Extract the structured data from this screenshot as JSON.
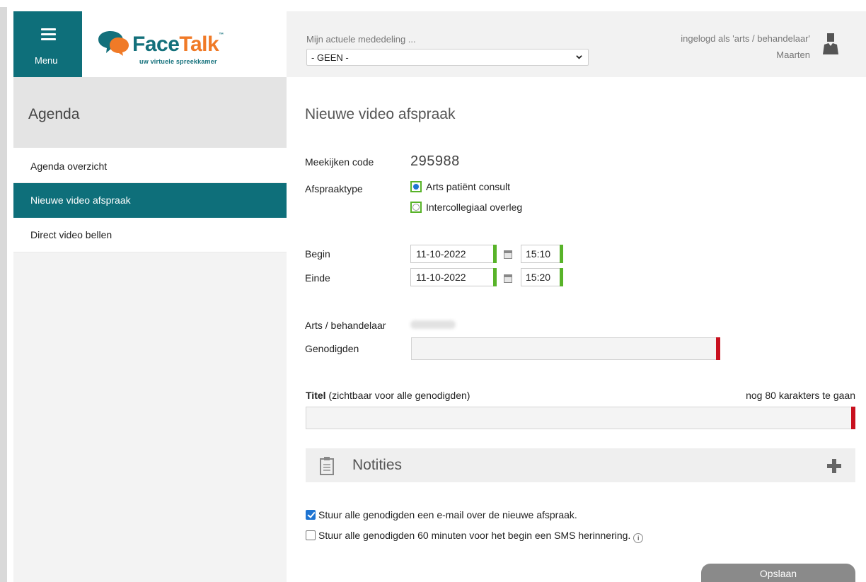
{
  "menu": {
    "label": "Menu",
    "icon": "hamburger-icon"
  },
  "logo": {
    "face": "Face",
    "talk": "Talk",
    "tm": "™",
    "tagline": "uw virtuele spreekkamer",
    "icon": "speech-bubbles-icon"
  },
  "header": {
    "notice_label": "Mijn actuele mededeling ...",
    "notice_value": "- GEEN -",
    "logged_in_as": "ingelogd als 'arts / behandelaar'",
    "user_name": "Maarten",
    "avatar_icon": "user-avatar-icon"
  },
  "sidebar": {
    "section_title": "Agenda",
    "items": [
      {
        "label": "Agenda overzicht",
        "active": false
      },
      {
        "label": "Nieuwe video afspraak",
        "active": true
      },
      {
        "label": "Direct video bellen",
        "active": false
      }
    ]
  },
  "form": {
    "page_title": "Nieuwe video afspraak",
    "code_label": "Meekijken code",
    "code_value": "295988",
    "type_label": "Afspraaktype",
    "type_options": [
      {
        "label": "Arts patiënt consult",
        "selected": true
      },
      {
        "label": "Intercollegiaal overleg",
        "selected": false
      }
    ],
    "begin_label": "Begin",
    "begin_date": "11-10-2022",
    "begin_time": "15:10",
    "end_label": "Einde",
    "end_date": "11-10-2022",
    "end_time": "15:20",
    "doctor_label": "Arts / behandelaar",
    "invitees_label": "Genodigden",
    "invitees_value": "",
    "title_label_bold": "Titel",
    "title_label_rest": " (zichtbaar voor alle genodigden)",
    "title_counter": "nog 80 karakters te gaan",
    "title_value": "",
    "notes_label": "Notities",
    "email_check_label": "Stuur alle genodigden een e-mail over de nieuwe afspraak.",
    "email_checked": true,
    "sms_check_label": "Stuur alle genodigden 60 minuten voor het begin een SMS herinnering.",
    "sms_checked": false,
    "info_icon": "ⓘ",
    "save_label": "Opslaan"
  },
  "colors": {
    "brand_teal": "#0e6f7a",
    "brand_orange": "#f07a27",
    "valid_green": "#58b329",
    "required_red": "#c8101e",
    "check_blue": "#1e74d2"
  }
}
